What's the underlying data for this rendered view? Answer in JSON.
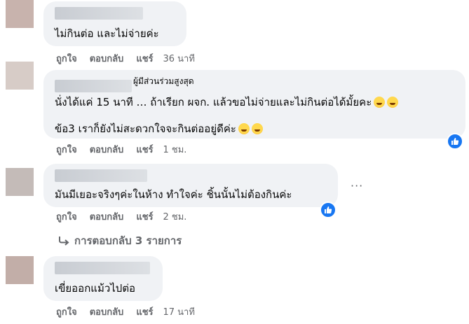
{
  "comments": [
    {
      "text_lines": [
        "ไม่กินต่อ และไม่จ่ายค่ะ"
      ],
      "actions": {
        "like": "ถูกใจ",
        "reply": "ตอบกลับ",
        "share": "แชร์",
        "time": "36 นาที"
      }
    },
    {
      "badge": "ผู้มีส่วนร่วมสูงสุด",
      "text_lines": [
        "นั่งได้แค่ 15 นาที … ถ้าเรียก ผจก. แล้วขอไม่จ่ายและไม่กินต่อได้มั้ยคะ",
        "ข้อ3 เราก็ยังไม่สะดวกใจจะกินต่ออยู่ดีค่ะ"
      ],
      "emojis": [
        "grinning-sweat-emoji",
        "grinning-sweat-emoji"
      ],
      "actions": {
        "like": "ถูกใจ",
        "reply": "ตอบกลับ",
        "share": "แชร์",
        "time": "1 ชม."
      },
      "reaction": "like"
    },
    {
      "text_lines": [
        "มันมีเยอะจริงๆค่ะในห้าง ทำใจค่ะ ชิ้นนั้นไม่ต้องกินค่ะ"
      ],
      "actions": {
        "like": "ถูกใจ",
        "reply": "ตอบกลับ",
        "share": "แชร์",
        "time": "2 ชม."
      },
      "reaction": "like",
      "more": "···",
      "replies_link": "การตอบกลับ 3 รายการ"
    },
    {
      "text_lines": [
        "เขี่ยออกแม้วไปต่อ"
      ],
      "actions": {
        "like": "ถูกใจ",
        "reply": "ตอบกลับ",
        "share": "แชร์",
        "time": "17 นาที"
      }
    }
  ],
  "colors": {
    "bubble": "#f0f2f5",
    "meta": "#65676b",
    "like_blue": "#1877f2",
    "text": "#050505"
  }
}
